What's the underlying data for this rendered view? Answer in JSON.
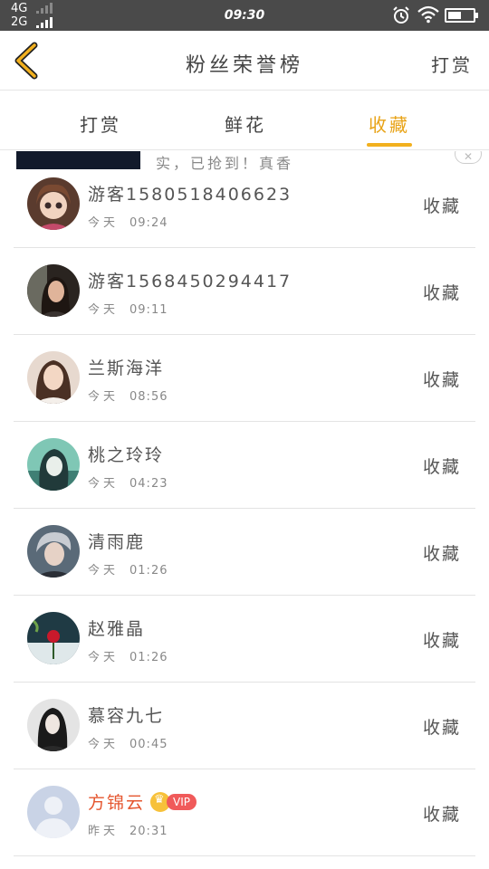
{
  "status_bar": {
    "network_1": "4G",
    "network_2": "2G",
    "time": "09:30"
  },
  "nav": {
    "title": "粉丝荣誉榜",
    "action_label": "打赏"
  },
  "tabs": [
    {
      "label": "打赏",
      "active": false
    },
    {
      "label": "鲜花",
      "active": false
    },
    {
      "label": "收藏",
      "active": true
    }
  ],
  "banner": {
    "text": "实，已抢到！真香"
  },
  "fans": [
    {
      "name": "游客1580518406623",
      "day": "今天",
      "time": "09:24",
      "action": "收藏",
      "vip": false,
      "avatar_icon": "doll-avatar"
    },
    {
      "name": "游客1568450294417",
      "day": "今天",
      "time": "09:11",
      "action": "收藏",
      "vip": false,
      "avatar_icon": "woman-portrait-avatar"
    },
    {
      "name": "兰斯海洋",
      "day": "今天",
      "time": "08:56",
      "action": "收藏",
      "vip": false,
      "avatar_icon": "woman-portrait-avatar"
    },
    {
      "name": "桃之玲玲",
      "day": "今天",
      "time": "04:23",
      "action": "收藏",
      "vip": false,
      "avatar_icon": "anime-avatar"
    },
    {
      "name": "清雨鹿",
      "day": "今天",
      "time": "01:26",
      "action": "收藏",
      "vip": false,
      "avatar_icon": "man-portrait-avatar"
    },
    {
      "name": "赵雅晶",
      "day": "今天",
      "time": "01:26",
      "action": "收藏",
      "vip": false,
      "avatar_icon": "rose-avatar"
    },
    {
      "name": "慕容九七",
      "day": "今天",
      "time": "00:45",
      "action": "收藏",
      "vip": false,
      "avatar_icon": "woman-portrait-avatar"
    },
    {
      "name": "方锦云",
      "day": "昨天",
      "time": "20:31",
      "action": "收藏",
      "vip": true,
      "vip_label": "VIP",
      "avatar_icon": "default-user-avatar"
    }
  ],
  "colors": {
    "accent": "#f2b01e",
    "active_tab": "#e8a317",
    "vip_name": "#e5562f",
    "vip_badge": "#f05a5a",
    "status_bar": "#4a4a4a"
  }
}
